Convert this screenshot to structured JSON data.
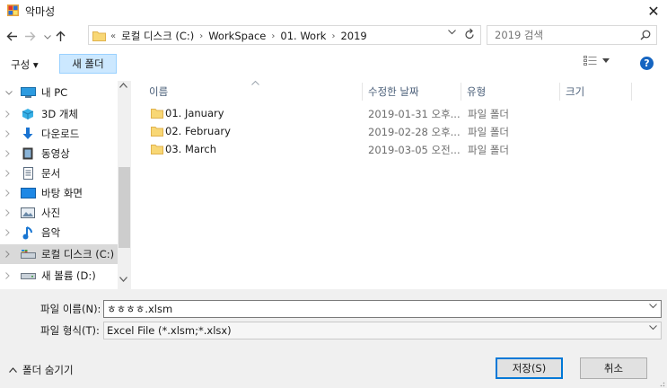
{
  "window": {
    "title": "악마성",
    "close_glyph": "✕"
  },
  "address": {
    "overflow": "«",
    "crumbs": [
      "로컬 디스크 (C:)",
      "WorkSpace",
      "01. Work",
      "2019"
    ],
    "separator": "›"
  },
  "search": {
    "placeholder": "2019 검색"
  },
  "toolbar": {
    "organize_label": "구성 ▾",
    "new_folder_label": "새 폴더"
  },
  "nav": {
    "items": [
      {
        "label": "내 PC",
        "icon": "pc-icon"
      },
      {
        "label": "3D 개체",
        "icon": "3d-objects-icon"
      },
      {
        "label": "다운로드",
        "icon": "download-icon"
      },
      {
        "label": "동영상",
        "icon": "video-icon"
      },
      {
        "label": "문서",
        "icon": "document-icon"
      },
      {
        "label": "바탕 화면",
        "icon": "desktop-icon"
      },
      {
        "label": "사진",
        "icon": "pictures-icon"
      },
      {
        "label": "음악",
        "icon": "music-icon"
      },
      {
        "label": "로컬 디스크 (C:)",
        "icon": "local-disk-icon"
      },
      {
        "label": "새 볼륨 (D:)",
        "icon": "drive-icon"
      }
    ],
    "selected_index": 8
  },
  "file_list": {
    "columns": [
      "이름",
      "수정한 날짜",
      "유형",
      "크기"
    ],
    "rows": [
      {
        "name": "01. January",
        "modified": "2019-01-31 오후...",
        "type": "파일 폴더"
      },
      {
        "name": "02. February",
        "modified": "2019-02-28 오후...",
        "type": "파일 폴더"
      },
      {
        "name": "03. March",
        "modified": "2019-03-05 오전...",
        "type": "파일 폴더"
      }
    ]
  },
  "form": {
    "filename_label": "파일 이름(N):",
    "filename_value": "ㅎㅎㅎㅎ.xlsm",
    "filetype_label": "파일 형식(T):",
    "filetype_value": "Excel File (*.xlsm;*.xlsx)"
  },
  "footer": {
    "hide_folders_label": "폴더 숨기기",
    "save_label": "저장(S)",
    "cancel_label": "취소"
  },
  "colors": {
    "accent": "#0078d7",
    "folder": "#f8d775",
    "selected_nav": "#d9d9d9",
    "new_folder_bg": "#cce8ff"
  }
}
